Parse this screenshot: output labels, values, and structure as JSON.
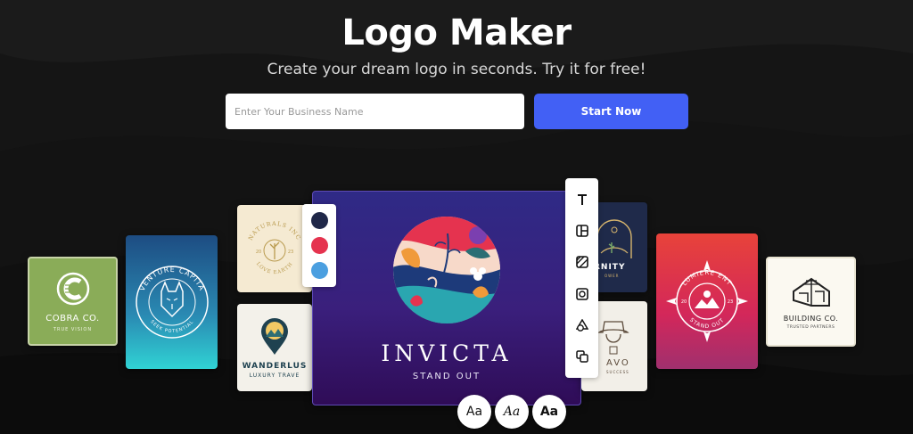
{
  "hero": {
    "title": "Logo Maker",
    "subtitle": "Create your dream logo in seconds. Try it for free!"
  },
  "search": {
    "placeholder": "Enter Your Business Name",
    "value": ""
  },
  "cta": {
    "label": "Start Now",
    "color": "#4260f5"
  },
  "cards": {
    "cobra": {
      "name": "COBRA CO.",
      "tagline": "TRUE VISION",
      "letter": "C"
    },
    "venture": {
      "name": "VENTURE CAPITA",
      "tagline": "SEEK POTENTIAL"
    },
    "naturals": {
      "name": "NATURALS INC",
      "tagline": "LOVE EARTH",
      "year_left": "20",
      "year_right": "23"
    },
    "wanderlust": {
      "name": "WANDERLUS",
      "tagline": "LUXURY TRAVE"
    },
    "invicta": {
      "name": "INVICTA",
      "tagline": "STAND OUT"
    },
    "eternity": {
      "name": "RNITY",
      "tagline": "OWER"
    },
    "bravo": {
      "name": "AVO",
      "tagline": "SUCCESS"
    },
    "lumiere": {
      "name": "LUMIERE ENT",
      "tagline": "STAND OUT",
      "year_left": "20",
      "year_right": "23"
    },
    "building": {
      "name": "BUILDING CO.",
      "tagline": "TRUSTED PARTNERS"
    }
  },
  "palette": {
    "colors": [
      "#1f2748",
      "#e5334f",
      "#4b9fe0"
    ]
  },
  "toolbar": {
    "tools": [
      "text-icon",
      "layout-icon",
      "background-icon",
      "frame-icon",
      "shape-icon",
      "layers-icon"
    ]
  },
  "fonts": {
    "regular": "Aa",
    "italic": "Aa",
    "bold": "Aa"
  }
}
